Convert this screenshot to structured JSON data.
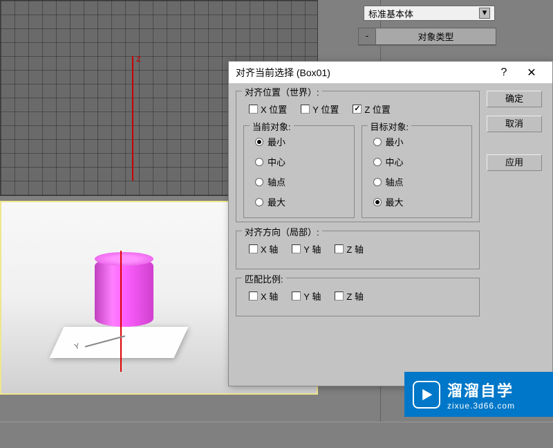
{
  "sidebar": {
    "dropdown_value": "标准基本体",
    "object_type_title": "对象类型",
    "collapse_symbol": "-"
  },
  "dialog": {
    "title": "对齐当前选择 (Box01)",
    "help": "?",
    "close": "✕",
    "buttons": {
      "ok": "确定",
      "cancel": "取消",
      "apply": "应用"
    },
    "align_position": {
      "legend": "对齐位置（世界）:",
      "x_label": "X 位置",
      "y_label": "Y 位置",
      "z_label": "Z 位置",
      "x_checked": false,
      "y_checked": false,
      "z_checked": true,
      "current_object": {
        "legend": "当前对象:",
        "min": "最小",
        "center": "中心",
        "pivot": "轴点",
        "max": "最大",
        "selected": "min"
      },
      "target_object": {
        "legend": "目标对象:",
        "min": "最小",
        "center": "中心",
        "pivot": "轴点",
        "max": "最大",
        "selected": "max"
      }
    },
    "align_orientation": {
      "legend": "对齐方向（局部）:",
      "x_label": "X 轴",
      "y_label": "Y 轴",
      "z_label": "Z 轴"
    },
    "match_scale": {
      "legend": "匹配比例:",
      "x_label": "X 轴",
      "y_label": "Y 轴",
      "z_label": "Z 轴"
    }
  },
  "watermark": {
    "brand": "溜溜自学",
    "url": "zixue.3d66.com"
  }
}
